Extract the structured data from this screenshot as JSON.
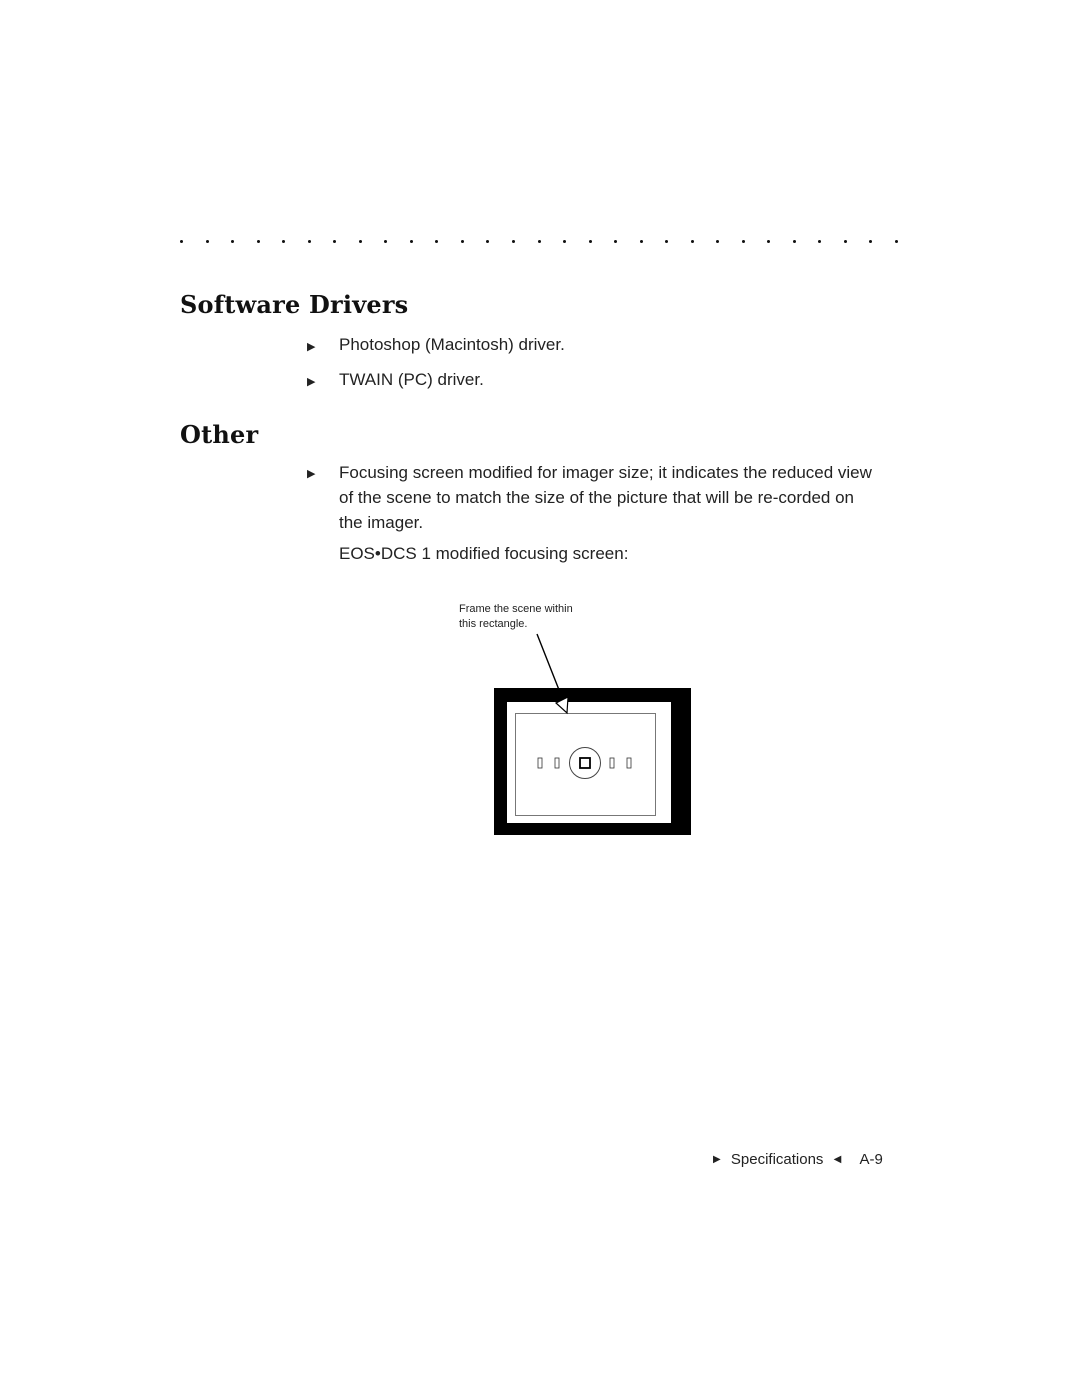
{
  "page": {
    "dot_rule_count": 29,
    "sections": [
      {
        "heading": "Software Drivers",
        "bullets": [
          "Photoshop (Macintosh) driver.",
          "TWAIN (PC) driver."
        ]
      },
      {
        "heading": "Other",
        "bullets": [
          "Focusing screen modified for imager size; it indicates the reduced view of the scene to match the size of the picture that will be re-corded on the imager."
        ],
        "note": "EOS•DCS 1 modified focusing screen:"
      }
    ],
    "figure": {
      "caption_line1": "Frame the scene within",
      "caption_line2": "this rectangle."
    },
    "footer": {
      "section_label": "Specifications",
      "page_number": "A-9"
    },
    "icons": {
      "bullet": "▶",
      "footer_left": "▶",
      "footer_right": "◀"
    }
  }
}
